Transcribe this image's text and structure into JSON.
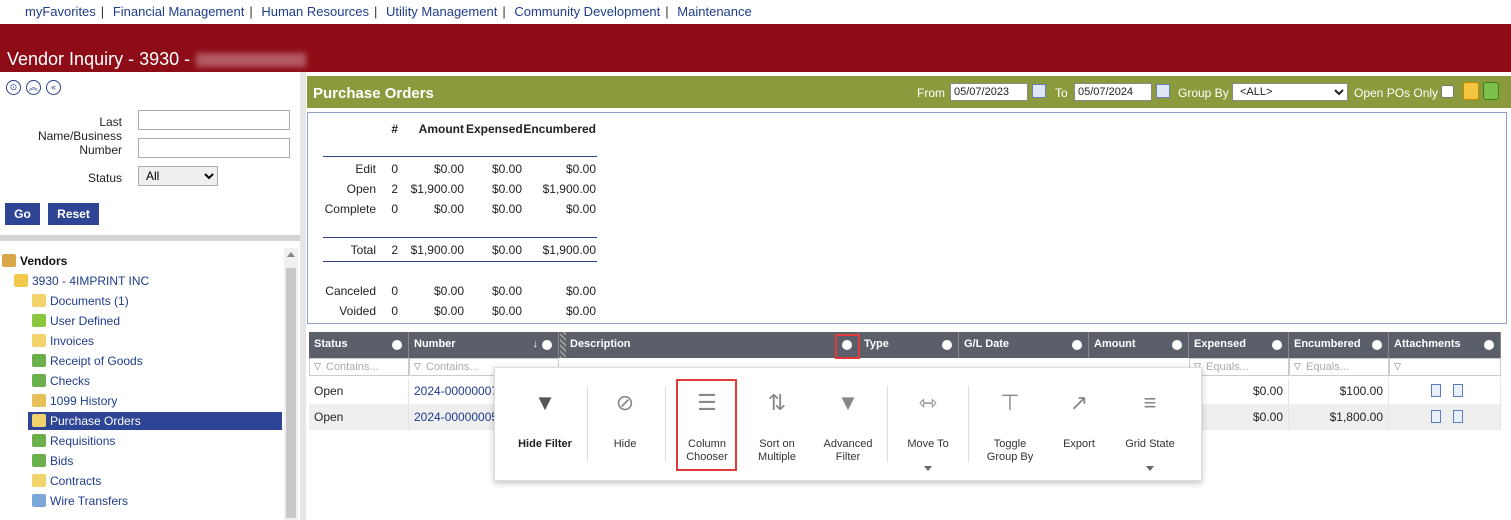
{
  "topnav": [
    "myFavorites",
    "Financial Management",
    "Human Resources",
    "Utility Management",
    "Community Development",
    "Maintenance"
  ],
  "page_title": "Vendor Inquiry - 3930 -",
  "search": {
    "last_name_label": "Last Name/Business",
    "number_label": "Number",
    "status_label": "Status",
    "status_value": "All",
    "go_label": "Go",
    "reset_label": "Reset"
  },
  "tree": {
    "root": "Vendors",
    "vendor": "3930 - 4IMPRINT INC",
    "items": [
      "Documents (1)",
      "User Defined",
      "Invoices",
      "Receipt of Goods",
      "Checks",
      "1099 History",
      "Purchase Orders",
      "Requisitions",
      "Bids",
      "Contracts",
      "Wire Transfers"
    ],
    "selected": "Purchase Orders"
  },
  "po_header": {
    "title": "Purchase Orders",
    "from_label": "From",
    "from_value": "05/07/2023",
    "to_label": "To",
    "to_value": "05/07/2024",
    "group_by_label": "Group By",
    "group_by_value": "<ALL>",
    "open_only_label": "Open POs Only"
  },
  "summary": {
    "headers": [
      "#",
      "Amount",
      "Expensed",
      "Encumbered"
    ],
    "rows": [
      {
        "label": "Edit",
        "count": "0",
        "amount": "$0.00",
        "expensed": "$0.00",
        "encumbered": "$0.00"
      },
      {
        "label": "Open",
        "count": "2",
        "amount": "$1,900.00",
        "expensed": "$0.00",
        "encumbered": "$1,900.00"
      },
      {
        "label": "Complete",
        "count": "0",
        "amount": "$0.00",
        "expensed": "$0.00",
        "encumbered": "$0.00"
      },
      {
        "label": "Total",
        "count": "2",
        "amount": "$1,900.00",
        "expensed": "$0.00",
        "encumbered": "$1,900.00"
      },
      {
        "label": "Canceled",
        "count": "0",
        "amount": "$0.00",
        "expensed": "$0.00",
        "encumbered": "$0.00"
      },
      {
        "label": "Voided",
        "count": "0",
        "amount": "$0.00",
        "expensed": "$0.00",
        "encumbered": "$0.00"
      }
    ]
  },
  "grid": {
    "columns": [
      "Status",
      "Number",
      "Description",
      "Type",
      "G/L Date",
      "Amount",
      "Expensed",
      "Encumbered",
      "Attachments"
    ],
    "filters": [
      "Contains...",
      "Contains...",
      "",
      "",
      "",
      "",
      "Equals...",
      "Equals...",
      ""
    ],
    "rows": [
      {
        "status": "Open",
        "number": "2024-00000007",
        "expensed": "$0.00",
        "encumbered": "$100.00"
      },
      {
        "status": "Open",
        "number": "2024-00000005",
        "expensed": "$0.00",
        "encumbered": "$1,800.00"
      }
    ]
  },
  "menu": {
    "items": [
      "Hide Filter",
      "Hide",
      "Column Chooser",
      "Sort on Multiple",
      "Advanced Filter",
      "Move To",
      "Toggle Group By",
      "Export",
      "Grid State"
    ]
  }
}
